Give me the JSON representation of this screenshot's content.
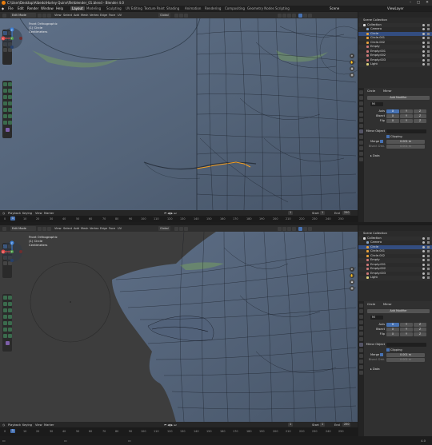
{
  "window": {
    "title": "C:\\User\\Desktop\\Albedo\\Harley Quinn\\file\\blender_01.blend - Blender 4.0",
    "controls": [
      "–",
      "□",
      "✕"
    ]
  },
  "menubar": {
    "menus": [
      "File",
      "Edit",
      "Render",
      "Window",
      "Help"
    ],
    "workspaces": [
      "Layout",
      "Modeling",
      "Sculpting",
      "UV Editing",
      "Texture Paint",
      "Shading",
      "Animation",
      "Rendering",
      "Compositing",
      "Geometry Nodes",
      "Scripting"
    ],
    "active_workspace": "Layout",
    "scene_label": "Scene",
    "viewlayer_label": "ViewLayer"
  },
  "top": {
    "viewport_header": {
      "mode": "Edit Mode",
      "menus": [
        "View",
        "Select",
        "Add",
        "Mesh",
        "Vertex",
        "Edge",
        "Face",
        "UV"
      ],
      "transform": "Global",
      "options": "Options"
    },
    "overlay": {
      "view": "Front Orthographic",
      "object": "(1) Circle",
      "units": "Centimeters"
    },
    "gizmo": {
      "x": "X",
      "y": "Y",
      "z": "Z"
    }
  },
  "bottom": {
    "viewport_header": {
      "mode": "Edit Mode",
      "menus": [
        "View",
        "Select",
        "Add",
        "Mesh",
        "Vertex",
        "Edge",
        "Face",
        "UV"
      ],
      "transform": "Global",
      "options": "Options"
    },
    "overlay": {
      "view": "Front Orthographic",
      "object": "(1) Circle",
      "units": "Centimeters"
    },
    "gizmo": {
      "x": "X",
      "y": "Y",
      "z": "Z"
    }
  },
  "timeline": {
    "menus": [
      "Playback",
      "Keying",
      "View",
      "Marker"
    ],
    "current_frame": "1",
    "start_label": "Start",
    "start": "1",
    "end_label": "End",
    "end": "250",
    "ticks": [
      "0",
      "10",
      "20",
      "30",
      "40",
      "50",
      "60",
      "70",
      "80",
      "90",
      "100",
      "110",
      "120",
      "130",
      "140",
      "150",
      "160",
      "170",
      "180",
      "190",
      "200",
      "210",
      "220",
      "230",
      "240",
      "250"
    ]
  },
  "outliner": {
    "title": "Scene Collection",
    "items": [
      {
        "name": "Collection",
        "indent": 0,
        "type": "collection",
        "state": "normal"
      },
      {
        "name": "Camera",
        "indent": 1,
        "type": "camera",
        "state": "normal"
      },
      {
        "name": "Circle",
        "indent": 1,
        "type": "mesh",
        "state": "selected"
      },
      {
        "name": "Circle.001",
        "indent": 1,
        "type": "mesh",
        "state": "normal"
      },
      {
        "name": "Circle.002",
        "indent": 1,
        "type": "mesh",
        "state": "normal"
      },
      {
        "name": "Empty",
        "indent": 1,
        "type": "empty",
        "state": "normal"
      },
      {
        "name": "Empty.001",
        "indent": 1,
        "type": "empty",
        "state": "normal"
      },
      {
        "name": "Empty.002",
        "indent": 1,
        "type": "empty",
        "state": "normal"
      },
      {
        "name": "Empty.003",
        "indent": 1,
        "type": "empty",
        "state": "normal"
      },
      {
        "name": "Light",
        "indent": 1,
        "type": "light",
        "state": "normal"
      }
    ]
  },
  "properties": {
    "object_name": "Circle",
    "modifier_target": "Mirror",
    "add_modifier": "Add Modifier",
    "modifier_name": "Mi",
    "axis_label": "Axis",
    "bisect_label": "Bisect",
    "flip_label": "Flip",
    "axes": [
      "X",
      "Y",
      "Z"
    ],
    "mirror_object_label": "Mirror Object",
    "clipping_label": "Clipping",
    "merge_label": "Merge",
    "merge_value": "0.001 m",
    "bisect_dist_label": "Bisect Dist.",
    "bisect_dist_value": "0.001 m",
    "data_label": "Data"
  },
  "statusbar": {
    "version": "4.0"
  },
  "colors": {
    "accent": "#4772b3",
    "mesh_face": "#5a6a82",
    "wire": "#101010",
    "selected_edge": "#f5a022",
    "eyelid_green": "#6d8f6a"
  }
}
